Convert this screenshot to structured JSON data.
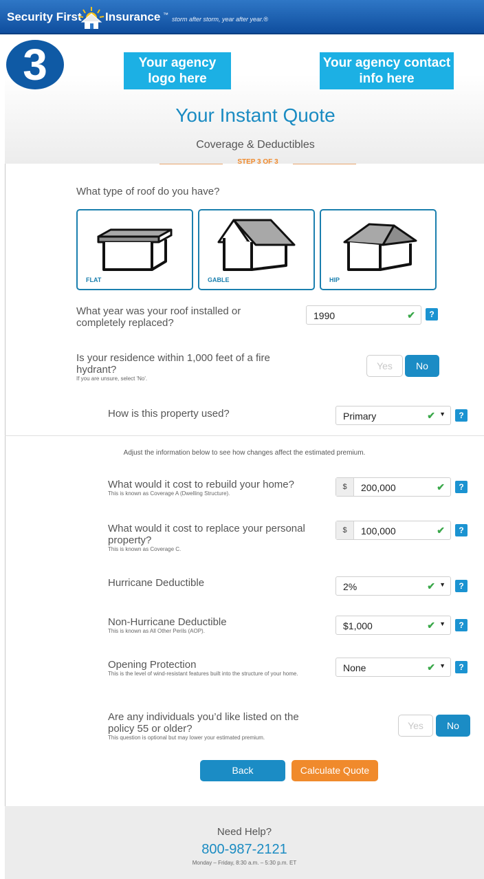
{
  "header": {
    "brand_part1": "Security First",
    "brand_part2": "Insurance",
    "trademark": "™",
    "tagline": "storm after storm, year after year.®"
  },
  "step_badge": "3",
  "agency": {
    "logo_text": "Your agency logo here",
    "contact_text": "Your agency contact info here"
  },
  "page": {
    "title": "Your Instant Quote",
    "subtitle": "Coverage & Deductibles",
    "step": "STEP 3 OF 3"
  },
  "roof": {
    "question": "What type of roof do you have?",
    "options": [
      {
        "label": "FLAT"
      },
      {
        "label": "GABLE"
      },
      {
        "label": "HIP"
      }
    ]
  },
  "roof_year": {
    "question": "What year was your roof installed or completely replaced?",
    "value": "1990"
  },
  "hydrant": {
    "question": "Is your residence within 1,000 feet of a fire hydrant?",
    "help": "If you are unsure, select 'No'.",
    "yes": "Yes",
    "no": "No",
    "selected": "No"
  },
  "property_use": {
    "question": "How is this property used?",
    "value": "Primary"
  },
  "adjust_note": "Adjust the information below to see how changes affect the estimated premium.",
  "coverage_a": {
    "question": "What would it cost to rebuild your home?",
    "help": "This is known as Coverage A (Dwelling Structure).",
    "prefix": "$",
    "value": "200,000"
  },
  "coverage_c": {
    "question": "What would it cost to replace your personal property?",
    "help": "This is known as Coverage C.",
    "prefix": "$",
    "value": "100,000"
  },
  "hurricane_deductible": {
    "question": "Hurricane Deductible",
    "value": "2%"
  },
  "aop_deductible": {
    "question": "Non-Hurricane Deductible",
    "help": "This is known as All Other Perils (AOP).",
    "value": "$1,000"
  },
  "opening_protection": {
    "question": "Opening Protection",
    "help": "This is the level of wind-resistant features built into the structure of your home.",
    "value": "None"
  },
  "seniors": {
    "question": "Are any individuals you’d like listed on the policy 55 or older?",
    "help": "This question is optional but may lower your estimated premium.",
    "yes": "Yes",
    "no": "No",
    "selected": "No"
  },
  "buttons": {
    "back": "Back",
    "calculate": "Calculate Quote"
  },
  "footer": {
    "help_title": "Need Help?",
    "phone": "800-987-2121",
    "hours": "Monday – Friday, 8:30 a.m. – 5:30 p.m. ET"
  },
  "glyphs": {
    "check": "✔",
    "caret": "▼",
    "help": "?"
  },
  "colors": {
    "brand_blue": "#1b8cc5",
    "accent_orange": "#f08a2c",
    "agency_cyan": "#1cb0e4",
    "check_green": "#3aa84a"
  }
}
